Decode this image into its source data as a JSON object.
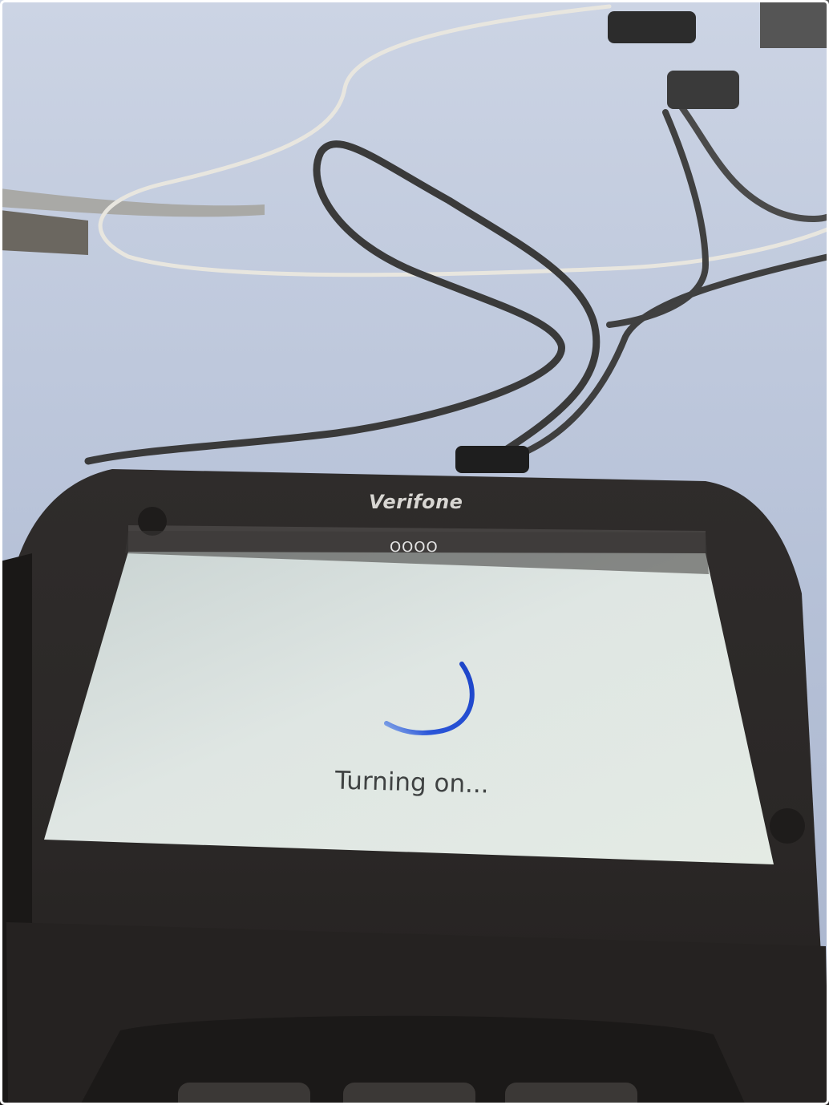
{
  "device": {
    "brand": "Verifone",
    "status_indicator": "OOOO",
    "status_message": "Turning on..."
  },
  "screen": {
    "spinner_icon": "loading-spinner-icon",
    "accent_color": "#1f4fd6",
    "background_color": "#e6ece9"
  },
  "scene": {
    "table_color": "#bcc7dc",
    "device_body_color": "#2a2726",
    "cable_color": "#3a3a3a"
  }
}
